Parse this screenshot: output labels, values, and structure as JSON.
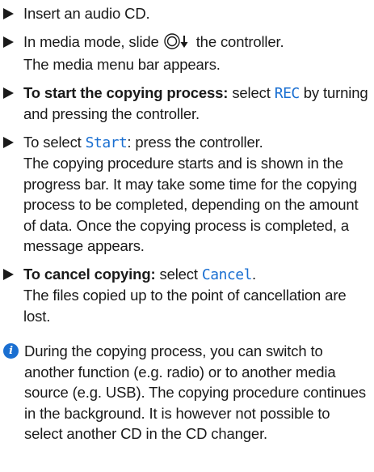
{
  "steps": [
    {
      "lead_text": "Insert an audio CD."
    },
    {
      "lead_before_icon": "In media mode, slide ",
      "icon": "controller-slide-down-icon",
      "lead_after_icon": " the controller.",
      "result": "The media menu bar appears."
    },
    {
      "bold_lead": "To start the copying process:",
      "text_before": " select ",
      "display_item": "REC",
      "text_after": " by turning and pressing the controller."
    },
    {
      "text_before": "To select ",
      "display_item": "Start",
      "text_after": ": press the controller.",
      "result": "The copying procedure starts and is shown in the progress bar. It may take some time for the copying process to be completed, depending on the amount of data. Once the copying process is completed, a message appears."
    },
    {
      "bold_lead": "To cancel copying:",
      "text_before": " select ",
      "display_item": "Cancel",
      "text_after": ".",
      "result": "The files copied up to the point of cancellation are lost."
    }
  ],
  "note": {
    "icon": "info-icon",
    "icon_glyph": "i",
    "text": "During the copying process, you can switch to another function (e.g. radio) or to another media source (e.g. USB). The copying procedure continues in the background. It is however not possible to select another CD in the CD changer."
  },
  "colors": {
    "text": "#1a1a1a",
    "display_item": "#1a6fd1",
    "info_icon": "#1a6fd1"
  }
}
